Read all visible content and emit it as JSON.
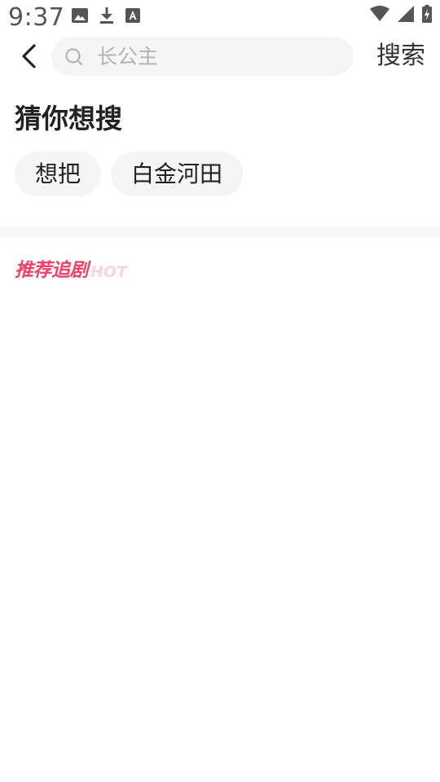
{
  "status_bar": {
    "time": "9:37",
    "left_icons": [
      "image-icon",
      "download-icon",
      "font-a-icon"
    ],
    "right_icons": [
      "wifi-icon",
      "cellular-signal-icon",
      "battery-icon"
    ]
  },
  "header": {
    "back_icon": "chevron-left-icon",
    "search": {
      "icon": "search-icon",
      "placeholder": "长公主",
      "value": ""
    },
    "search_button_label": "搜索"
  },
  "suggestions": {
    "title": "猜你想搜",
    "items": [
      "想把",
      "白金河田"
    ]
  },
  "recommend": {
    "title": "推荐追剧",
    "badge": "HOT"
  },
  "colors": {
    "accent": "#f04368",
    "accent_light": "#fcd3dd",
    "chip_bg": "#f5f5f5",
    "divider": "#f6f7fa"
  }
}
